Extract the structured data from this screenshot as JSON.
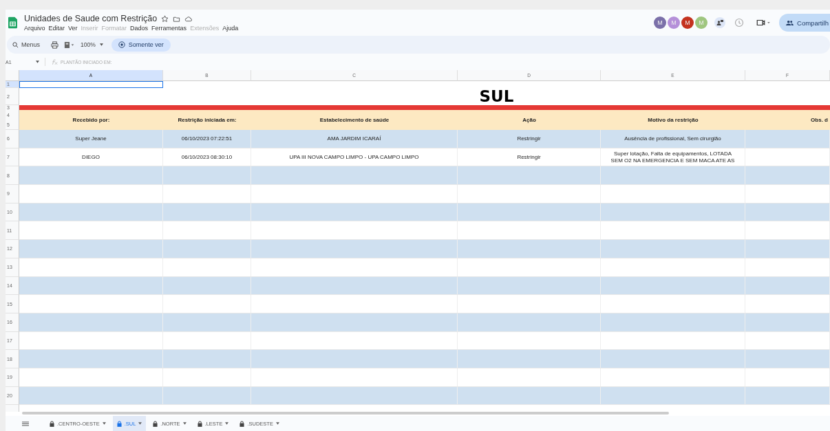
{
  "document": {
    "title": "Unidades de Saude com Restrição"
  },
  "menu": [
    {
      "label": "Arquivo",
      "disabled": false
    },
    {
      "label": "Editar",
      "disabled": false
    },
    {
      "label": "Ver",
      "disabled": false
    },
    {
      "label": "Inserir",
      "disabled": true
    },
    {
      "label": "Formatar",
      "disabled": true
    },
    {
      "label": "Dados",
      "disabled": false
    },
    {
      "label": "Ferramentas",
      "disabled": false
    },
    {
      "label": "Extensões",
      "disabled": true
    },
    {
      "label": "Ajuda",
      "disabled": false
    }
  ],
  "collaborators": [
    {
      "initial": "M",
      "color": "#7b70a9"
    },
    {
      "initial": "M",
      "color": "#b590d9"
    },
    {
      "initial": "M",
      "color": "#c4321f"
    },
    {
      "initial": "M",
      "color": "#9fc67f"
    }
  ],
  "share_button": "Compartilh",
  "toolbar": {
    "search": "Menus",
    "zoom": "100%",
    "mode": "Somente ver"
  },
  "formula_bar": {
    "cell": "A1",
    "value": "PLANTÃO INICIADO EM:"
  },
  "columns": [
    {
      "label": "A",
      "selected": true
    },
    {
      "label": "B",
      "selected": false
    },
    {
      "label": "C",
      "selected": false
    },
    {
      "label": "D",
      "selected": false
    },
    {
      "label": "E",
      "selected": false
    },
    {
      "label": "F",
      "selected": false
    }
  ],
  "rows": [
    {
      "kind": "blank",
      "numbers": [
        "1"
      ],
      "selected": true
    },
    {
      "kind": "title",
      "numbers": [
        "2"
      ],
      "text": "SUL"
    },
    {
      "kind": "rule",
      "numbers": [
        "3"
      ]
    },
    {
      "kind": "header",
      "numbers": [
        "4",
        "5"
      ],
      "cells": [
        "Recebido por:",
        "Restrição iniciada em:",
        "Estabelecimento de saúde",
        "Ação",
        "Motivo da restrição",
        "Obs. d"
      ]
    },
    {
      "kind": "data",
      "numbers": [
        "6"
      ],
      "shaded": true,
      "cells": [
        "Super Jeane",
        "06/10/2023 07:22:51",
        "AMA JARDIM ICARAÍ",
        "Restringir",
        "Ausência de profissional, Sem cirurgião"
      ]
    },
    {
      "kind": "data",
      "numbers": [
        "7"
      ],
      "shaded": false,
      "cells": [
        "DIEGO",
        "06/10/2023 08:30:10",
        "UPA III NOVA CAMPO LIMPO - UPA CAMPO LIMPO",
        "Restringir",
        "Super lotação, Falta de equipamentos, LOTADA\nSEM O2 NA EMERGENCIA E SEM MACA ATE AS"
      ]
    },
    {
      "kind": "data",
      "numbers": [
        "8"
      ],
      "shaded": true,
      "cells": []
    },
    {
      "kind": "data",
      "numbers": [
        "9"
      ],
      "shaded": false,
      "cells": []
    },
    {
      "kind": "data",
      "numbers": [
        "10"
      ],
      "shaded": true,
      "cells": []
    },
    {
      "kind": "data",
      "numbers": [
        "11"
      ],
      "shaded": false,
      "cells": []
    },
    {
      "kind": "data",
      "numbers": [
        "12"
      ],
      "shaded": true,
      "cells": []
    },
    {
      "kind": "data",
      "numbers": [
        "13"
      ],
      "shaded": false,
      "cells": []
    },
    {
      "kind": "data",
      "numbers": [
        "14"
      ],
      "shaded": true,
      "cells": []
    },
    {
      "kind": "data",
      "numbers": [
        "15"
      ],
      "shaded": false,
      "cells": []
    },
    {
      "kind": "data",
      "numbers": [
        "16"
      ],
      "shaded": true,
      "cells": []
    },
    {
      "kind": "data",
      "numbers": [
        "17"
      ],
      "shaded": false,
      "cells": []
    },
    {
      "kind": "data",
      "numbers": [
        "18"
      ],
      "shaded": true,
      "cells": []
    },
    {
      "kind": "data",
      "numbers": [
        "19"
      ],
      "shaded": false,
      "cells": []
    },
    {
      "kind": "data",
      "numbers": [
        "20"
      ],
      "shaded": true,
      "cells": []
    }
  ],
  "sheet_tabs": [
    {
      "label": ".CENTRO-OESTE",
      "selected": false
    },
    {
      "label": ".SUL",
      "selected": true
    },
    {
      "label": ".NORTE",
      "selected": false
    },
    {
      "label": ".LESTE",
      "selected": false
    },
    {
      "label": ".SUDESTE",
      "selected": false
    }
  ]
}
